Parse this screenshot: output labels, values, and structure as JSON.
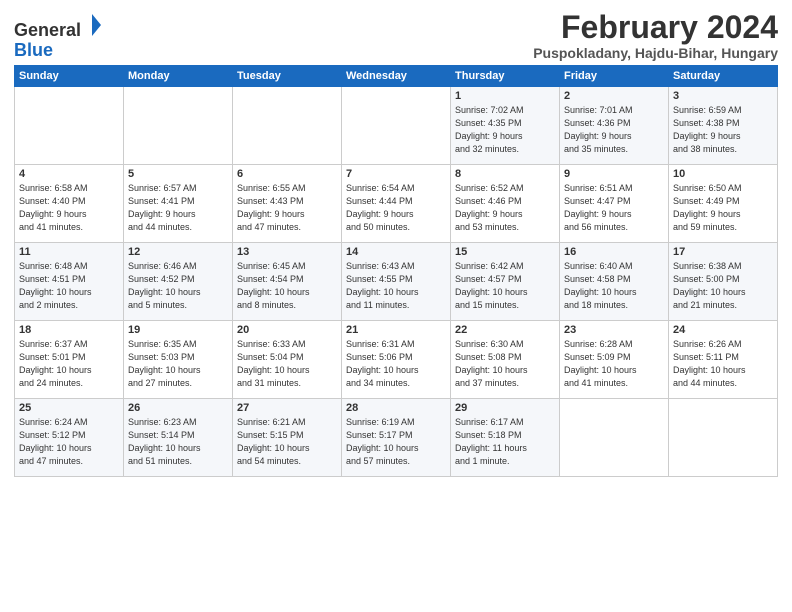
{
  "logo": {
    "general": "General",
    "blue": "Blue"
  },
  "header": {
    "title": "February 2024",
    "subtitle": "Puspokladany, Hajdu-Bihar, Hungary"
  },
  "days_of_week": [
    "Sunday",
    "Monday",
    "Tuesday",
    "Wednesday",
    "Thursday",
    "Friday",
    "Saturday"
  ],
  "weeks": [
    [
      {
        "day": "",
        "info": ""
      },
      {
        "day": "",
        "info": ""
      },
      {
        "day": "",
        "info": ""
      },
      {
        "day": "",
        "info": ""
      },
      {
        "day": "1",
        "info": "Sunrise: 7:02 AM\nSunset: 4:35 PM\nDaylight: 9 hours\nand 32 minutes."
      },
      {
        "day": "2",
        "info": "Sunrise: 7:01 AM\nSunset: 4:36 PM\nDaylight: 9 hours\nand 35 minutes."
      },
      {
        "day": "3",
        "info": "Sunrise: 6:59 AM\nSunset: 4:38 PM\nDaylight: 9 hours\nand 38 minutes."
      }
    ],
    [
      {
        "day": "4",
        "info": "Sunrise: 6:58 AM\nSunset: 4:40 PM\nDaylight: 9 hours\nand 41 minutes."
      },
      {
        "day": "5",
        "info": "Sunrise: 6:57 AM\nSunset: 4:41 PM\nDaylight: 9 hours\nand 44 minutes."
      },
      {
        "day": "6",
        "info": "Sunrise: 6:55 AM\nSunset: 4:43 PM\nDaylight: 9 hours\nand 47 minutes."
      },
      {
        "day": "7",
        "info": "Sunrise: 6:54 AM\nSunset: 4:44 PM\nDaylight: 9 hours\nand 50 minutes."
      },
      {
        "day": "8",
        "info": "Sunrise: 6:52 AM\nSunset: 4:46 PM\nDaylight: 9 hours\nand 53 minutes."
      },
      {
        "day": "9",
        "info": "Sunrise: 6:51 AM\nSunset: 4:47 PM\nDaylight: 9 hours\nand 56 minutes."
      },
      {
        "day": "10",
        "info": "Sunrise: 6:50 AM\nSunset: 4:49 PM\nDaylight: 9 hours\nand 59 minutes."
      }
    ],
    [
      {
        "day": "11",
        "info": "Sunrise: 6:48 AM\nSunset: 4:51 PM\nDaylight: 10 hours\nand 2 minutes."
      },
      {
        "day": "12",
        "info": "Sunrise: 6:46 AM\nSunset: 4:52 PM\nDaylight: 10 hours\nand 5 minutes."
      },
      {
        "day": "13",
        "info": "Sunrise: 6:45 AM\nSunset: 4:54 PM\nDaylight: 10 hours\nand 8 minutes."
      },
      {
        "day": "14",
        "info": "Sunrise: 6:43 AM\nSunset: 4:55 PM\nDaylight: 10 hours\nand 11 minutes."
      },
      {
        "day": "15",
        "info": "Sunrise: 6:42 AM\nSunset: 4:57 PM\nDaylight: 10 hours\nand 15 minutes."
      },
      {
        "day": "16",
        "info": "Sunrise: 6:40 AM\nSunset: 4:58 PM\nDaylight: 10 hours\nand 18 minutes."
      },
      {
        "day": "17",
        "info": "Sunrise: 6:38 AM\nSunset: 5:00 PM\nDaylight: 10 hours\nand 21 minutes."
      }
    ],
    [
      {
        "day": "18",
        "info": "Sunrise: 6:37 AM\nSunset: 5:01 PM\nDaylight: 10 hours\nand 24 minutes."
      },
      {
        "day": "19",
        "info": "Sunrise: 6:35 AM\nSunset: 5:03 PM\nDaylight: 10 hours\nand 27 minutes."
      },
      {
        "day": "20",
        "info": "Sunrise: 6:33 AM\nSunset: 5:04 PM\nDaylight: 10 hours\nand 31 minutes."
      },
      {
        "day": "21",
        "info": "Sunrise: 6:31 AM\nSunset: 5:06 PM\nDaylight: 10 hours\nand 34 minutes."
      },
      {
        "day": "22",
        "info": "Sunrise: 6:30 AM\nSunset: 5:08 PM\nDaylight: 10 hours\nand 37 minutes."
      },
      {
        "day": "23",
        "info": "Sunrise: 6:28 AM\nSunset: 5:09 PM\nDaylight: 10 hours\nand 41 minutes."
      },
      {
        "day": "24",
        "info": "Sunrise: 6:26 AM\nSunset: 5:11 PM\nDaylight: 10 hours\nand 44 minutes."
      }
    ],
    [
      {
        "day": "25",
        "info": "Sunrise: 6:24 AM\nSunset: 5:12 PM\nDaylight: 10 hours\nand 47 minutes."
      },
      {
        "day": "26",
        "info": "Sunrise: 6:23 AM\nSunset: 5:14 PM\nDaylight: 10 hours\nand 51 minutes."
      },
      {
        "day": "27",
        "info": "Sunrise: 6:21 AM\nSunset: 5:15 PM\nDaylight: 10 hours\nand 54 minutes."
      },
      {
        "day": "28",
        "info": "Sunrise: 6:19 AM\nSunset: 5:17 PM\nDaylight: 10 hours\nand 57 minutes."
      },
      {
        "day": "29",
        "info": "Sunrise: 6:17 AM\nSunset: 5:18 PM\nDaylight: 11 hours\nand 1 minute."
      },
      {
        "day": "",
        "info": ""
      },
      {
        "day": "",
        "info": ""
      }
    ]
  ]
}
